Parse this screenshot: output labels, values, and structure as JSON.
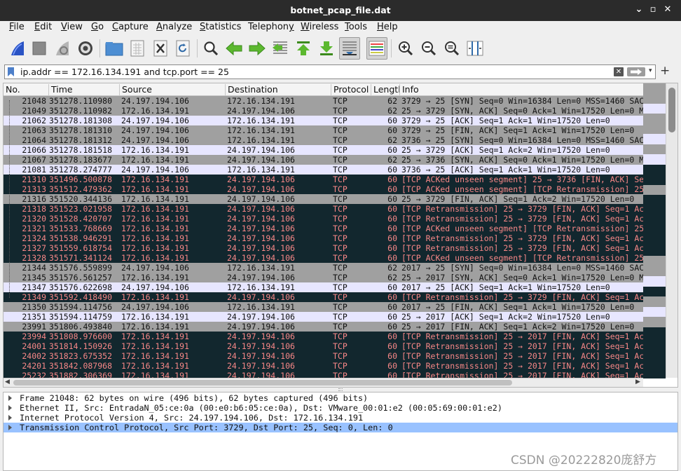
{
  "window": {
    "title": "botnet_pcap_file.dat",
    "controls": [
      "⌄",
      "▫",
      "✕"
    ]
  },
  "menu": [
    {
      "pre": "",
      "u": "F",
      "post": "ile"
    },
    {
      "pre": "",
      "u": "E",
      "post": "dit"
    },
    {
      "pre": "",
      "u": "V",
      "post": "iew"
    },
    {
      "pre": "",
      "u": "G",
      "post": "o"
    },
    {
      "pre": "",
      "u": "C",
      "post": "apture"
    },
    {
      "pre": "",
      "u": "A",
      "post": "nalyze"
    },
    {
      "pre": "",
      "u": "S",
      "post": "tatistics"
    },
    {
      "pre": "Telephon",
      "u": "y",
      "post": ""
    },
    {
      "pre": "",
      "u": "W",
      "post": "ireless"
    },
    {
      "pre": "",
      "u": "T",
      "post": "ools"
    },
    {
      "pre": "",
      "u": "H",
      "post": "elp"
    }
  ],
  "toolbar": {
    "icons": [
      "shark-fin-start-icon",
      "stop-square-icon",
      "restart-capture-icon",
      "capture-options-gear-icon",
      "open-folder-icon",
      "file-grid-icon",
      "close-file-icon",
      "reload-file-icon",
      "find-packet-magnifier-icon",
      "go-back-arrow-icon",
      "go-forward-arrow-icon",
      "go-to-packet-icon",
      "go-first-packet-icon",
      "go-last-packet-icon",
      "autoscroll-icon",
      "colorize-icon",
      "zoom-in-icon",
      "zoom-out-icon",
      "zoom-normal-icon",
      "resize-columns-icon"
    ]
  },
  "filter": {
    "value": "ip.addr == 172.16.134.191 and tcp.port == 25",
    "clear_glyph": "✕",
    "drop_glyph": "▾",
    "add_glyph": "+"
  },
  "packet_list": {
    "columns": [
      "No.",
      "Time",
      "Source",
      "Destination",
      "Protocol",
      "Length",
      "Info"
    ],
    "rows": [
      {
        "no": "21048",
        "time": "351278.110980",
        "src": "24.197.194.106",
        "dst": "172.16.134.191",
        "proto": "TCP",
        "len": "62",
        "info": "3729 → 25 [SYN] Seq=0 Win=16384 Len=0 MSS=1460 SACK_PERM",
        "style": "g"
      },
      {
        "no": "21049",
        "time": "351278.110982",
        "src": "172.16.134.191",
        "dst": "24.197.194.106",
        "proto": "TCP",
        "len": "62",
        "info": "25 → 3729 [SYN, ACK] Seq=0 Ack=1 Win=17520 Len=0 MSS=1460",
        "style": "g"
      },
      {
        "no": "21062",
        "time": "351278.181308",
        "src": "24.197.194.106",
        "dst": "172.16.134.191",
        "proto": "TCP",
        "len": "60",
        "info": "3729 → 25 [ACK] Seq=1 Ack=1 Win=17520 Len=0",
        "style": "l"
      },
      {
        "no": "21063",
        "time": "351278.181310",
        "src": "24.197.194.106",
        "dst": "172.16.134.191",
        "proto": "TCP",
        "len": "60",
        "info": "3729 → 25 [FIN, ACK] Seq=1 Ack=1 Win=17520 Len=0",
        "style": "g"
      },
      {
        "no": "21064",
        "time": "351278.181312",
        "src": "24.197.194.106",
        "dst": "172.16.134.191",
        "proto": "TCP",
        "len": "62",
        "info": "3736 → 25 [SYN] Seq=0 Win=16384 Len=0 MSS=1460 SACK_PERM",
        "style": "g"
      },
      {
        "no": "21066",
        "time": "351278.181518",
        "src": "172.16.134.191",
        "dst": "24.197.194.106",
        "proto": "TCP",
        "len": "60",
        "info": "25 → 3729 [ACK] Seq=1 Ack=2 Win=17520 Len=0",
        "style": "l"
      },
      {
        "no": "21067",
        "time": "351278.183677",
        "src": "172.16.134.191",
        "dst": "24.197.194.106",
        "proto": "TCP",
        "len": "62",
        "info": "25 → 3736 [SYN, ACK] Seq=0 Ack=1 Win=17520 Len=0 MSS=1460",
        "style": "g"
      },
      {
        "no": "21081",
        "time": "351278.274777",
        "src": "24.197.194.106",
        "dst": "172.16.134.191",
        "proto": "TCP",
        "len": "60",
        "info": "3736 → 25 [ACK] Seq=1 Ack=1 Win=17520 Len=0",
        "style": "l"
      },
      {
        "no": "21310",
        "time": "351496.500878",
        "src": "172.16.134.191",
        "dst": "24.197.194.106",
        "proto": "TCP",
        "len": "60",
        "info": "[TCP ACKed unseen segment] 25 → 3736 [FIN, ACK] Seq=1",
        "style": "d"
      },
      {
        "no": "21313",
        "time": "351512.479362",
        "src": "172.16.134.191",
        "dst": "24.197.194.106",
        "proto": "TCP",
        "len": "60",
        "info": "[TCP ACKed unseen segment] [TCP Retransmission] 25 → 37",
        "style": "d"
      },
      {
        "no": "21316",
        "time": "351520.344136",
        "src": "172.16.134.191",
        "dst": "24.197.194.106",
        "proto": "TCP",
        "len": "60",
        "info": "25 → 3729 [FIN, ACK] Seq=1 Ack=2 Win=17520 Len=0",
        "style": "g"
      },
      {
        "no": "21318",
        "time": "351523.021958",
        "src": "172.16.134.191",
        "dst": "24.197.194.106",
        "proto": "TCP",
        "len": "60",
        "info": "[TCP Retransmission] 25 → 3729 [FIN, ACK] Seq=1 Ack=2",
        "style": "d"
      },
      {
        "no": "21320",
        "time": "351528.420707",
        "src": "172.16.134.191",
        "dst": "24.197.194.106",
        "proto": "TCP",
        "len": "60",
        "info": "[TCP Retransmission] 25 → 3729 [FIN, ACK] Seq=1 Ack=2",
        "style": "d"
      },
      {
        "no": "21321",
        "time": "351533.768669",
        "src": "172.16.134.191",
        "dst": "24.197.194.106",
        "proto": "TCP",
        "len": "60",
        "info": "[TCP ACKed unseen segment] [TCP Retransmission] 25 → 37",
        "style": "d"
      },
      {
        "no": "21324",
        "time": "351538.946291",
        "src": "172.16.134.191",
        "dst": "24.197.194.106",
        "proto": "TCP",
        "len": "60",
        "info": "[TCP Retransmission] 25 → 3729 [FIN, ACK] Seq=1 Ack=2",
        "style": "d"
      },
      {
        "no": "21327",
        "time": "351559.618754",
        "src": "172.16.134.191",
        "dst": "24.197.194.106",
        "proto": "TCP",
        "len": "60",
        "info": "[TCP Retransmission] 25 → 3729 [FIN, ACK] Seq=1 Ack=2",
        "style": "d"
      },
      {
        "no": "21328",
        "time": "351571.341124",
        "src": "172.16.134.191",
        "dst": "24.197.194.106",
        "proto": "TCP",
        "len": "60",
        "info": "[TCP ACKed unseen segment] [TCP Retransmission] 25 → 37",
        "style": "d"
      },
      {
        "no": "21344",
        "time": "351576.559899",
        "src": "24.197.194.106",
        "dst": "172.16.134.191",
        "proto": "TCP",
        "len": "62",
        "info": "2017 → 25 [SYN] Seq=0 Win=16384 Len=0 MSS=1460 SACK_PERM",
        "style": "g"
      },
      {
        "no": "21345",
        "time": "351576.561257",
        "src": "172.16.134.191",
        "dst": "24.197.194.106",
        "proto": "TCP",
        "len": "62",
        "info": "25 → 2017 [SYN, ACK] Seq=0 Ack=1 Win=17520 Len=0 MSS=1460",
        "style": "g"
      },
      {
        "no": "21347",
        "time": "351576.622698",
        "src": "24.197.194.106",
        "dst": "172.16.134.191",
        "proto": "TCP",
        "len": "60",
        "info": "2017 → 25 [ACK] Seq=1 Ack=1 Win=17520 Len=0",
        "style": "l"
      },
      {
        "no": "21349",
        "time": "351592.418490",
        "src": "172.16.134.191",
        "dst": "24.197.194.106",
        "proto": "TCP",
        "len": "60",
        "info": "[TCP Retransmission] 25 → 3729 [FIN, ACK] Seq=1 Ack=2",
        "style": "d"
      },
      {
        "no": "21350",
        "time": "351594.114756",
        "src": "24.197.194.106",
        "dst": "172.16.134.191",
        "proto": "TCP",
        "len": "60",
        "info": "2017 → 25 [FIN, ACK] Seq=1 Ack=1 Win=17520 Len=0",
        "style": "g"
      },
      {
        "no": "21351",
        "time": "351594.114759",
        "src": "172.16.134.191",
        "dst": "24.197.194.106",
        "proto": "TCP",
        "len": "60",
        "info": "25 → 2017 [ACK] Seq=1 Ack=2 Win=17520 Len=0",
        "style": "l"
      },
      {
        "no": "23991",
        "time": "351806.493840",
        "src": "172.16.134.191",
        "dst": "24.197.194.106",
        "proto": "TCP",
        "len": "60",
        "info": "25 → 2017 [FIN, ACK] Seq=1 Ack=2 Win=17520 Len=0",
        "style": "g"
      },
      {
        "no": "23994",
        "time": "351808.976600",
        "src": "172.16.134.191",
        "dst": "24.197.194.106",
        "proto": "TCP",
        "len": "60",
        "info": "[TCP Retransmission] 25 → 2017 [FIN, ACK] Seq=1 Ack=2",
        "style": "d"
      },
      {
        "no": "24001",
        "time": "351814.150926",
        "src": "172.16.134.191",
        "dst": "24.197.194.106",
        "proto": "TCP",
        "len": "60",
        "info": "[TCP Retransmission] 25 → 2017 [FIN, ACK] Seq=1 Ack=2",
        "style": "d"
      },
      {
        "no": "24002",
        "time": "351823.675352",
        "src": "172.16.134.191",
        "dst": "24.197.194.106",
        "proto": "TCP",
        "len": "60",
        "info": "[TCP Retransmission] 25 → 2017 [FIN, ACK] Seq=1 Ack=2",
        "style": "d"
      },
      {
        "no": "24201",
        "time": "351842.087968",
        "src": "172.16.134.191",
        "dst": "24.197.194.106",
        "proto": "TCP",
        "len": "60",
        "info": "[TCP Retransmission] 25 → 2017 [FIN, ACK] Seq=1 Ack=2",
        "style": "d"
      },
      {
        "no": "25232",
        "time": "351882.306369",
        "src": "172.16.134.191",
        "dst": "24.197.194.106",
        "proto": "TCP",
        "len": "60",
        "info": "[TCP Retransmission] 25 → 2017 [FIN, ACK] Seq=1 Ack=2",
        "style": "d"
      }
    ]
  },
  "details": [
    {
      "text": "Frame 21048: 62 bytes on wire (496 bits), 62 bytes captured (496 bits)",
      "selected": false
    },
    {
      "text": "Ethernet II, Src: EntradaN_05:ce:0a (00:e0:b6:05:ce:0a), Dst: VMware_00:01:e2 (00:05:69:00:01:e2)",
      "selected": false
    },
    {
      "text": "Internet Protocol Version 4, Src: 24.197.194.106, Dst: 172.16.134.191",
      "selected": false
    },
    {
      "text": "Transmission Control Protocol, Src Port: 3729, Dst Port: 25, Seq: 0, Len: 0",
      "selected": true
    }
  ],
  "watermark": "CSDN @20222820庞舒方",
  "colors": {
    "gray_row": "#a0a0a0",
    "lavender_row": "#e7e6ff",
    "dark_row": "#12272e",
    "dark_row_text": "#f78787",
    "selection": "#99c2ff"
  }
}
